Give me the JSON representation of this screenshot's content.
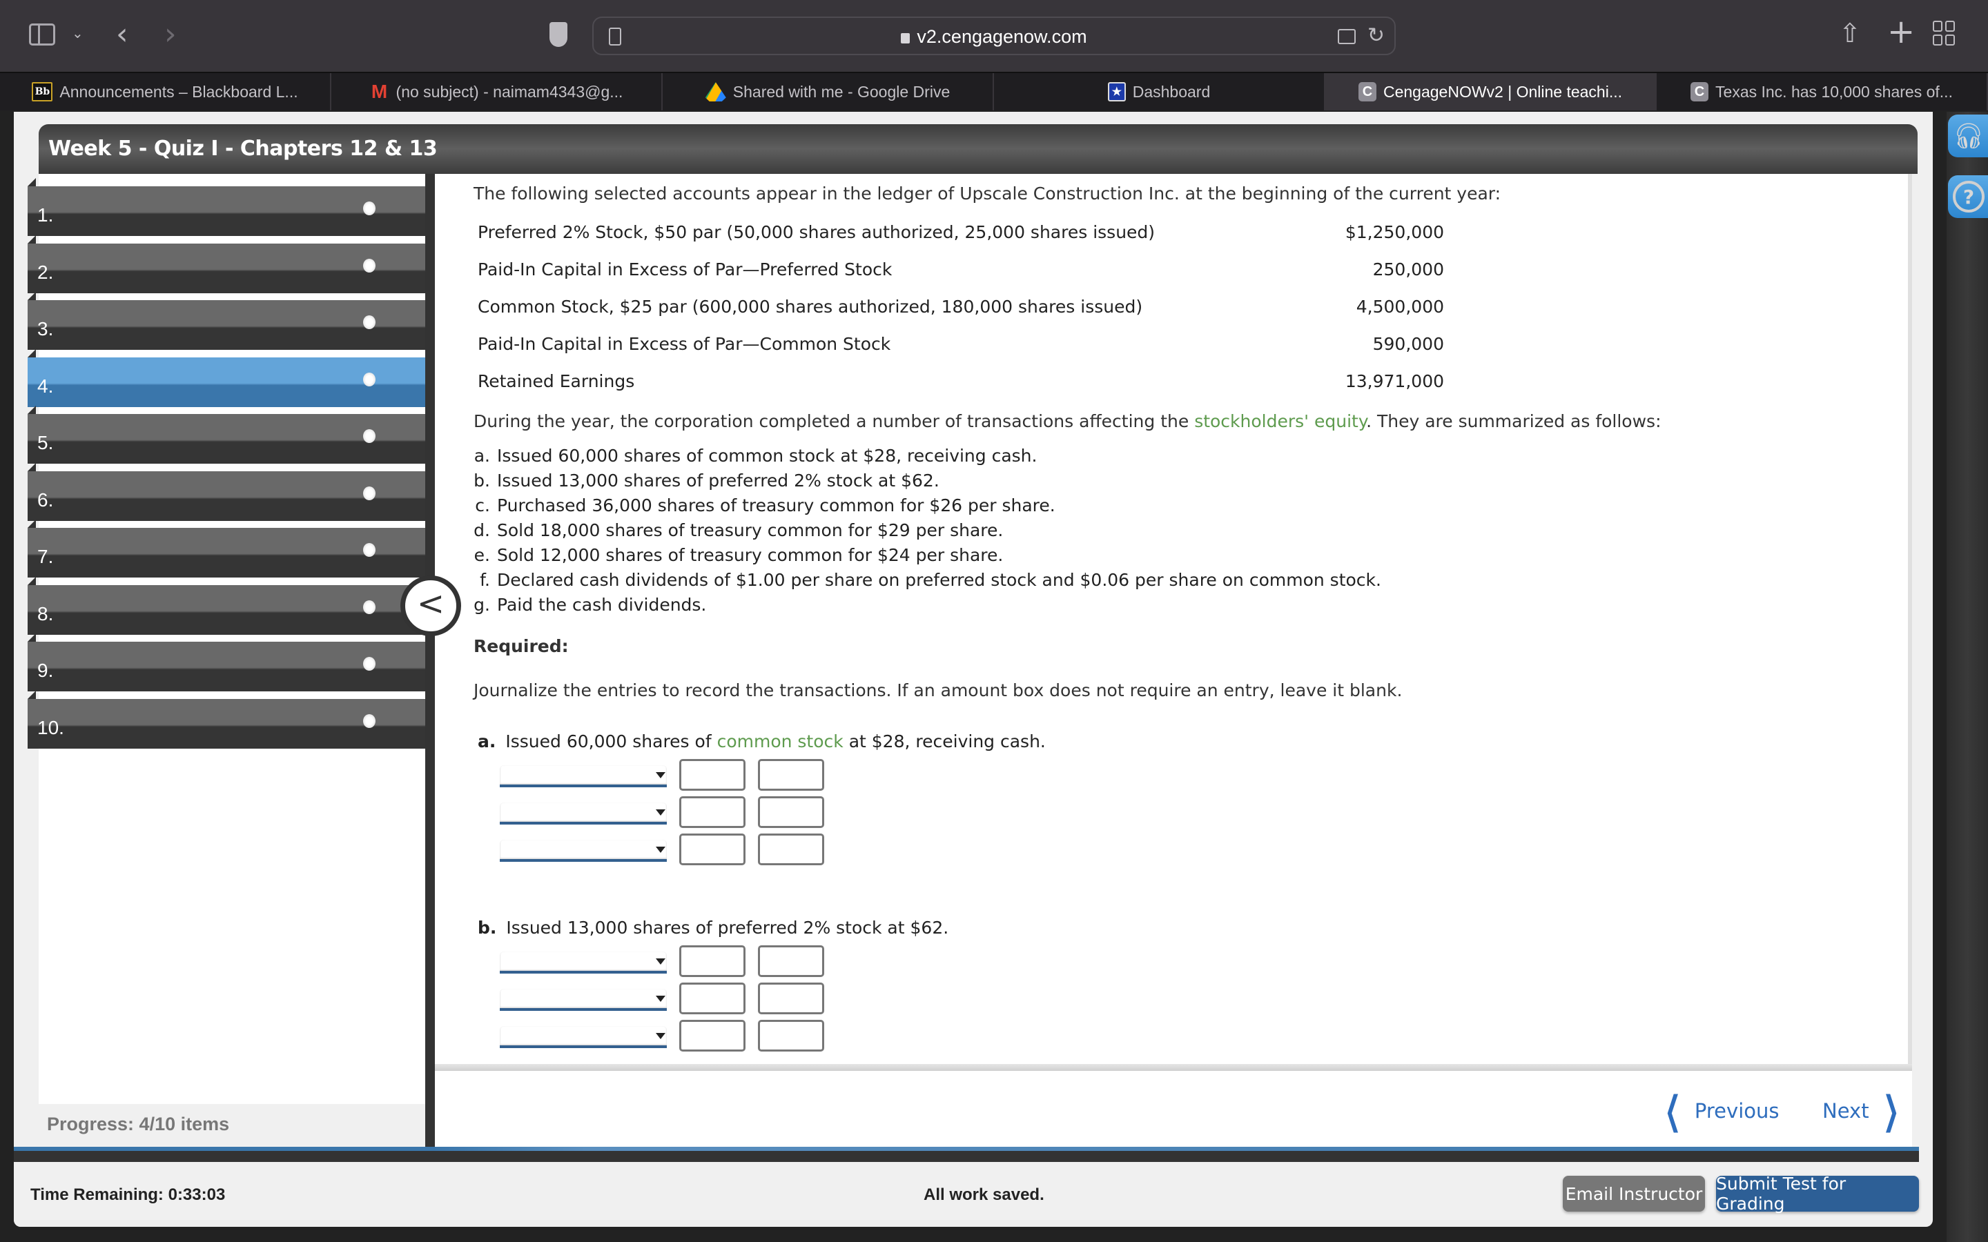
{
  "browser": {
    "url": "v2.cengagenow.com",
    "tabs": [
      {
        "label": "Announcements – Blackboard L...",
        "icon": "blackboard-icon",
        "favicon_text": "Bb",
        "active": false
      },
      {
        "label": "(no subject) - naimam4343@g...",
        "icon": "gmail-icon",
        "favicon_text": "M",
        "active": false
      },
      {
        "label": "Shared with me - Google Drive",
        "icon": "google-drive-icon",
        "favicon_text": "",
        "active": false
      },
      {
        "label": "Dashboard",
        "icon": "dashboard-star-icon",
        "favicon_text": "★",
        "active": false
      },
      {
        "label": "CengageNOWv2 | Online teachi...",
        "icon": "cengage-icon",
        "favicon_text": "C",
        "active": true
      },
      {
        "label": "Texas Inc. has 10,000 shares of...",
        "icon": "cengage-icon",
        "favicon_text": "C",
        "active": false
      }
    ],
    "glyphs": {
      "back": "‹",
      "forward": "›",
      "chevron_down": "⌄",
      "reload": "↻",
      "share": "⇧",
      "plus": "+"
    }
  },
  "quiz": {
    "title": "Week 5 - Quiz I - Chapters 12 & 13",
    "questions": [
      "1.",
      "2.",
      "3.",
      "4.",
      "5.",
      "6.",
      "7.",
      "8.",
      "9.",
      "10."
    ],
    "active_question": 4,
    "progress_label": "Progress:  4/10 items",
    "progress": {
      "completed": 4,
      "total": 10
    },
    "collapse_glyph": "<"
  },
  "content": {
    "intro": "The following selected accounts appear in the ledger of Upscale Construction Inc. at the beginning of the current year:",
    "ledger": [
      {
        "account": "Preferred 2% Stock, $50 par (50,000 shares authorized, 25,000 shares issued)",
        "amount": "$1,250,000"
      },
      {
        "account": "Paid-In Capital in Excess of Par—Preferred Stock",
        "amount": "250,000"
      },
      {
        "account": "Common Stock, $25 par (600,000 shares authorized, 180,000 shares issued)",
        "amount": "4,500,000"
      },
      {
        "account": "Paid-In Capital in Excess of Par—Common Stock",
        "amount": "590,000"
      },
      {
        "account": "Retained Earnings",
        "amount": "13,971,000"
      }
    ],
    "during_pre": "During the year, the corporation completed a number of transactions affecting the ",
    "during_link": "stockholders' equity",
    "during_post": ". They are summarized as follows:",
    "transactions": [
      {
        "letter": "a.",
        "text": "Issued 60,000 shares of common stock at $28, receiving cash."
      },
      {
        "letter": "b.",
        "text": "Issued 13,000 shares of preferred 2% stock at $62."
      },
      {
        "letter": "c.",
        "text": "Purchased 36,000 shares of treasury common for $26 per share."
      },
      {
        "letter": "d.",
        "text": "Sold 18,000 shares of treasury common for $29 per share."
      },
      {
        "letter": "e.",
        "text": "Sold 12,000 shares of treasury common for $24 per share."
      },
      {
        "letter": "f.",
        "text": "Declared cash dividends of $1.00 per share on preferred stock and $0.06 per share on common stock."
      },
      {
        "letter": "g.",
        "text": "Paid the cash dividends."
      }
    ],
    "required_label": "Required:",
    "instructions": "Journalize the entries to record the transactions. If an amount box does not require an entry, leave it blank.",
    "parts": [
      {
        "letter": "a.",
        "pre": "Issued 60,000 shares of ",
        "link": "common stock",
        "post": " at $28, receiving cash.",
        "rows": 3
      },
      {
        "letter": "b.",
        "pre": "Issued 13,000 shares of preferred 2% stock at $62.",
        "link": "",
        "post": "",
        "rows": 3
      }
    ]
  },
  "navigation": {
    "previous_label": "Previous",
    "next_label": "Next",
    "prev_glyph": "❮",
    "next_glyph": "❯"
  },
  "status": {
    "time_remaining": "Time Remaining: 0:33:03",
    "saved": "All work saved.",
    "email_button": "Email Instructor",
    "submit_button": "Submit Test for Grading"
  },
  "side_rail": {
    "support_icon": "headset-icon",
    "help_glyph": "?"
  },
  "colors": {
    "accent_blue": "#2d5f96",
    "link_green": "#5e9b4e",
    "active_question_blue": "#3a76ab",
    "nav_blue": "#2e6dbd"
  }
}
